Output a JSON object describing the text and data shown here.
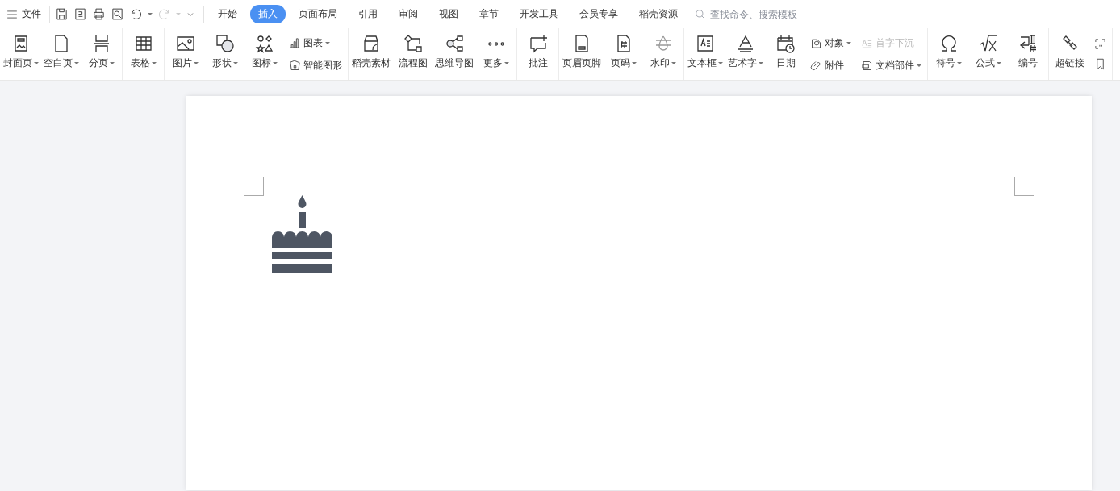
{
  "menu": {
    "label": "文件"
  },
  "tabs": [
    {
      "label": "开始",
      "selected": false
    },
    {
      "label": "插入",
      "selected": true
    },
    {
      "label": "页面布局",
      "selected": false
    },
    {
      "label": "引用",
      "selected": false
    },
    {
      "label": "审阅",
      "selected": false
    },
    {
      "label": "视图",
      "selected": false
    },
    {
      "label": "章节",
      "selected": false
    },
    {
      "label": "开发工具",
      "selected": false
    },
    {
      "label": "会员专享",
      "selected": false
    },
    {
      "label": "稻壳资源",
      "selected": false
    }
  ],
  "search": {
    "placeholder": "查找命令、搜索模板"
  },
  "ribbon_groups": [
    {
      "items": [
        {
          "kind": "large",
          "label": "封面页",
          "dropdown": true
        },
        {
          "kind": "large",
          "label": "空白页",
          "dropdown": true
        },
        {
          "kind": "large",
          "label": "分页",
          "dropdown": true
        }
      ]
    },
    {
      "items": [
        {
          "kind": "large",
          "label": "表格",
          "dropdown": true
        }
      ]
    },
    {
      "items": [
        {
          "kind": "large",
          "label": "图片",
          "dropdown": true
        },
        {
          "kind": "large",
          "label": "形状",
          "dropdown": true
        },
        {
          "kind": "large",
          "label": "图标",
          "dropdown": true
        },
        {
          "kind": "stack",
          "entries": [
            {
              "label": "图表",
              "dropdown": true,
              "disabled": false
            },
            {
              "label": "智能图形",
              "dropdown": false,
              "disabled": false
            }
          ]
        }
      ]
    },
    {
      "items": [
        {
          "kind": "large",
          "label": "稻壳素材",
          "dropdown": false
        },
        {
          "kind": "large",
          "label": "流程图",
          "dropdown": false
        },
        {
          "kind": "large",
          "label": "思维导图",
          "dropdown": false
        },
        {
          "kind": "large",
          "label": "更多",
          "dropdown": true
        }
      ]
    },
    {
      "items": [
        {
          "kind": "large",
          "label": "批注",
          "dropdown": false
        }
      ]
    },
    {
      "items": [
        {
          "kind": "large",
          "label": "页眉页脚",
          "dropdown": false
        },
        {
          "kind": "large",
          "label": "页码",
          "dropdown": true
        },
        {
          "kind": "large",
          "label": "水印",
          "dropdown": true
        }
      ]
    },
    {
      "items": [
        {
          "kind": "large",
          "label": "文本框",
          "dropdown": true
        },
        {
          "kind": "large",
          "label": "艺术字",
          "dropdown": true
        },
        {
          "kind": "large",
          "label": "日期",
          "dropdown": false
        },
        {
          "kind": "stack",
          "entries": [
            {
              "label": "对象",
              "dropdown": true,
              "disabled": false
            },
            {
              "label": "附件",
              "dropdown": false,
              "disabled": false
            }
          ]
        },
        {
          "kind": "stack",
          "entries": [
            {
              "label": "首字下沉",
              "dropdown": false,
              "disabled": true
            },
            {
              "label": "文档部件",
              "dropdown": true,
              "disabled": false
            }
          ]
        }
      ]
    },
    {
      "items": [
        {
          "kind": "large",
          "label": "符号",
          "dropdown": true
        },
        {
          "kind": "large",
          "label": "公式",
          "dropdown": true
        },
        {
          "kind": "large",
          "label": "编号",
          "dropdown": false
        }
      ]
    },
    {
      "items": [
        {
          "kind": "large",
          "label": "超链接",
          "dropdown": false
        },
        {
          "kind": "icon_pair"
        }
      ]
    }
  ],
  "document": {
    "content": [
      {
        "kind": "cake_icon"
      }
    ]
  }
}
